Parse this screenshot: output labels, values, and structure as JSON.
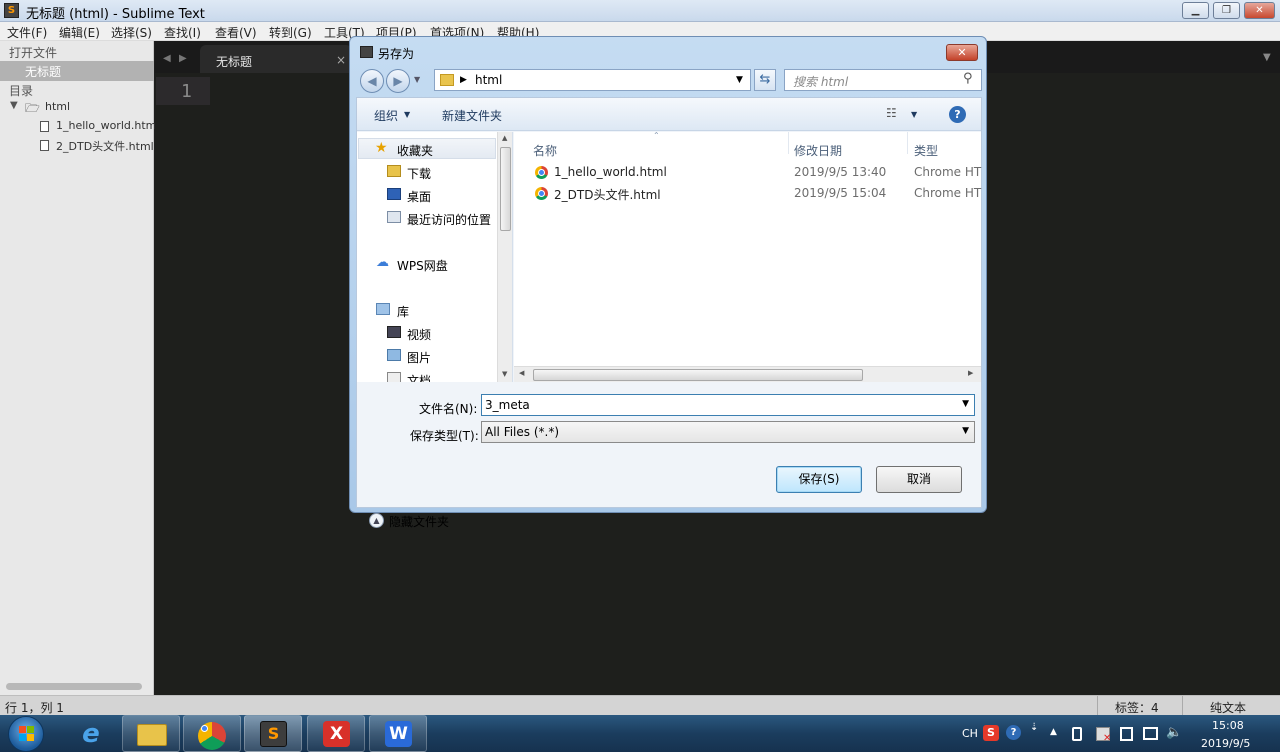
{
  "window": {
    "title": "无标题 (html) - Sublime Text",
    "icon": "sublime-text-icon"
  },
  "menu": [
    "文件(F)",
    "编辑(E)",
    "选择(S)",
    "查找(I)",
    "查看(V)",
    "转到(G)",
    "工具(T)",
    "项目(P)",
    "首选项(N)",
    "帮助(H)"
  ],
  "sidebar": {
    "open_files_label": "打开文件",
    "open_file": "无标题",
    "folders_label": "目录",
    "folder": "html",
    "files": [
      "1_hello_world.html",
      "2_DTD头文件.html"
    ]
  },
  "editor": {
    "tab_label": "无标题",
    "tab_close": "×",
    "line_number": "1"
  },
  "status": {
    "position": "行 1，列 1",
    "tab_size": "标签：4",
    "syntax": "纯文本"
  },
  "dialog": {
    "title": "另存为",
    "close": "✕",
    "address": {
      "path": "html"
    },
    "search_placeholder": "搜索 html",
    "toolbar": {
      "organize": "组织",
      "new_folder": "新建文件夹"
    },
    "nav_pane": {
      "favorites": "收藏夹",
      "downloads": "下载",
      "desktop": "桌面",
      "recent": "最近访问的位置",
      "wps": "WPS网盘",
      "libraries": "库",
      "videos": "视频",
      "pictures": "图片",
      "documents": "文档"
    },
    "columns": {
      "name": "名称",
      "modified": "修改日期",
      "type": "类型"
    },
    "files": [
      {
        "name": "1_hello_world.html",
        "modified": "2019/9/5 13:40",
        "type": "Chrome HT"
      },
      {
        "name": "2_DTD头文件.html",
        "modified": "2019/9/5 15:04",
        "type": "Chrome HT"
      }
    ],
    "filename_label": "文件名(N):",
    "filename_value": "3_meta",
    "filetype_label": "保存类型(T):",
    "filetype_value": "All Files (*.*)",
    "hide_folders": "隐藏文件夹",
    "save_button": "保存(S)",
    "cancel_button": "取消"
  },
  "taskbar": {
    "apps": [
      "ie-icon",
      "explorer-icon",
      "chrome-icon",
      "sublime-icon",
      "wps-x-icon",
      "wps-w-icon"
    ],
    "lang": "CH",
    "time": "15:08",
    "date": "2019/9/5"
  }
}
